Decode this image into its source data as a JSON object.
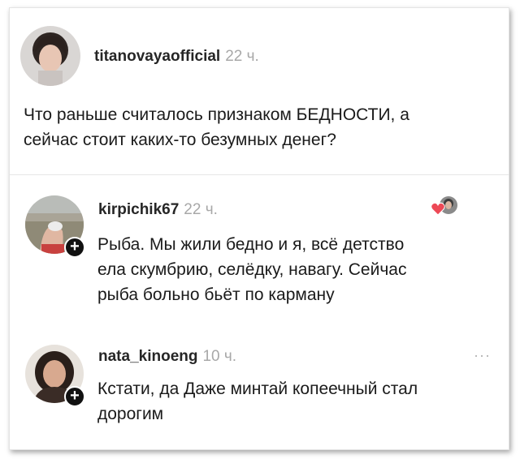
{
  "post": {
    "username": "titanovayaofficial",
    "time": "22 ч.",
    "text_line1": "Что раньше считалось признаком БЕДНОСТИ, а",
    "text_line2": "сейчас стоит каких-то безумных денег?"
  },
  "comments": [
    {
      "username": "kirpichik67",
      "time": "22 ч.",
      "lines": [
        "Рыба. Мы жили бедно и я, всё детство",
        "ела скумбрию, селёдку, навагу. Сейчас",
        "рыба больно бьёт по карману"
      ],
      "add_badge": "+",
      "reaction_icon": "author-liked-heart-icon"
    },
    {
      "username": "nata_kinoeng",
      "time": "10 ч.",
      "lines": [
        "Кстати, да Даже минтай копеечный стал",
        "дорогим"
      ],
      "add_badge": "+",
      "more": "···"
    }
  ],
  "colors": {
    "heart": "#ed4956",
    "time": "#a8a8a8",
    "divider": "#e6e6e6"
  }
}
